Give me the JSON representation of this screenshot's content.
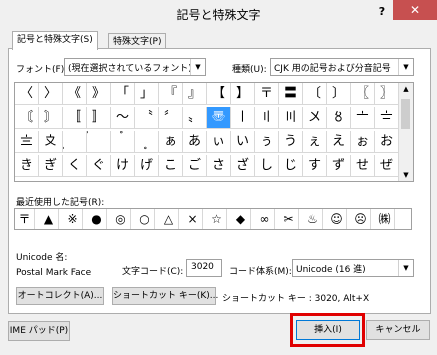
{
  "window": {
    "title": "記号と特殊文字",
    "help": "?",
    "close": "✕"
  },
  "tabs": [
    {
      "label": "記号と特殊文字(S)"
    },
    {
      "label": "特殊文字(P)"
    }
  ],
  "font": {
    "label": "フォント(F):",
    "value": "(現在選択されているフォント)"
  },
  "subset": {
    "label": "種類(U):",
    "value": "CJK 用の記号および分音記号"
  },
  "grid": {
    "rows": [
      [
        "〈",
        "〉",
        "《",
        "》",
        "「",
        "」",
        "『",
        "』",
        "【",
        "】",
        "〒",
        "〓",
        "〔",
        "〕",
        "〖",
        "〗"
      ],
      [
        "〘",
        "〙",
        "〚",
        "〛",
        "〜",
        "〝",
        "〞",
        "〟",
        "〠",
        "〡",
        "〢",
        "〣",
        "〤",
        "〥",
        "〦",
        "〧"
      ],
      [
        "〨",
        "〩",
        "〪",
        "〫",
        "〬",
        "〭",
        "ぁ",
        "あ",
        "ぃ",
        "い",
        "ぅ",
        "う",
        "ぇ",
        "え",
        "ぉ",
        "お"
      ],
      [
        "き",
        "ぎ",
        "く",
        "ぐ",
        "け",
        "げ",
        "こ",
        "ご",
        "さ",
        "ざ",
        "し",
        "じ",
        "す",
        "ず",
        "せ",
        "ぜ"
      ]
    ]
  },
  "recent": {
    "label": "最近使用した記号(R):",
    "items": [
      "〒",
      "▲",
      "※",
      "●",
      "◎",
      "○",
      "△",
      "×",
      "☆",
      "◆",
      "∞",
      "✂",
      "♨",
      "☺",
      "☹",
      "㈱"
    ]
  },
  "unicode": {
    "name_label": "Unicode 名:",
    "name_value": "Postal Mark Face"
  },
  "charcode": {
    "label": "文字コード(C):",
    "value": "3020"
  },
  "codesystem": {
    "label": "コード体系(M):",
    "value": "Unicode (16 進)"
  },
  "buttons": {
    "autocorrect": "オートコレクト(A)...",
    "shortcut": "ショートカット キー(K)...",
    "ime_pad": "IME パッド(P)",
    "insert": "挿入(I)",
    "cancel": "キャンセル"
  },
  "shortcut_text": "ショートカット キー : 3020, Alt+X",
  "colors": {
    "selection": "#3399ff",
    "highlight": "#e00000",
    "close": "#c75050"
  }
}
